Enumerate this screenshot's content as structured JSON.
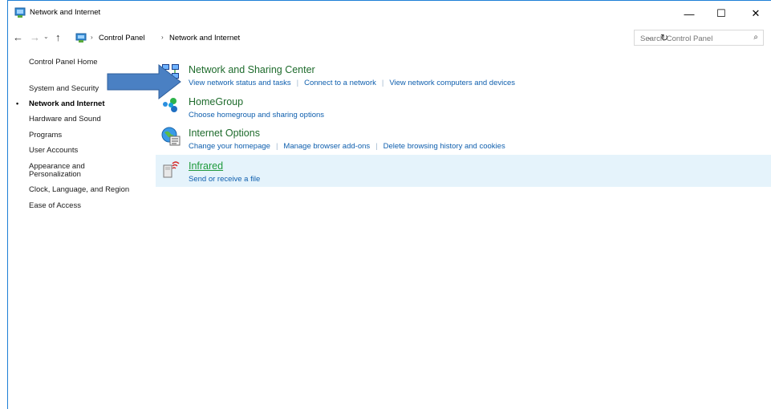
{
  "window": {
    "title": "Network and Internet",
    "minimize_glyph": "—",
    "maximize_glyph": "☐",
    "close_glyph": "✕"
  },
  "navigation": {
    "back_glyph": "←",
    "forward_glyph": "→",
    "recent_glyph": "⌄",
    "up_glyph": "↑",
    "breadcrumb": [
      "Control Panel",
      "Network and Internet"
    ],
    "separator": "›",
    "dropdown_glyph": "⌄",
    "refresh_glyph": "↻",
    "search_placeholder": "Search Control Panel",
    "search_glyph": "⌕"
  },
  "sidebar": {
    "items": [
      {
        "label": "Control Panel Home",
        "active": false
      },
      {
        "label": "System and Security",
        "active": false
      },
      {
        "label": "Network and Internet",
        "active": true
      },
      {
        "label": "Hardware and Sound",
        "active": false
      },
      {
        "label": "Programs",
        "active": false
      },
      {
        "label": "User Accounts",
        "active": false
      },
      {
        "label": "Appearance and",
        "active": false
      },
      {
        "label": "Personalization",
        "active": false
      },
      {
        "label": "Clock, Language, and Region",
        "active": false
      },
      {
        "label": "Ease of Access",
        "active": false
      }
    ],
    "bullet": "•"
  },
  "categories": [
    {
      "title": "Network and Sharing Center",
      "icon": "network-sharing-icon",
      "links": [
        "View network status and tasks",
        "Connect to a network",
        "View network computers and devices"
      ]
    },
    {
      "title": "HomeGroup",
      "icon": "homegroup-icon",
      "links": [
        "Choose homegroup and sharing options"
      ]
    },
    {
      "title": "Internet Options",
      "icon": "internet-options-icon",
      "links": [
        "Change your homepage",
        "Manage browser add-ons",
        "Delete browsing history and cookies"
      ]
    },
    {
      "title": "Infrared",
      "icon": "infrared-icon",
      "links": [
        "Send or receive a file"
      ],
      "hovered": true
    }
  ],
  "colors": {
    "accent_border": "#1e7fd6",
    "link": "#0f5fae",
    "category_title": "#1e6b2c",
    "hover_row": "#e5f3fb",
    "annotation_arrow": "#4a80c3"
  }
}
